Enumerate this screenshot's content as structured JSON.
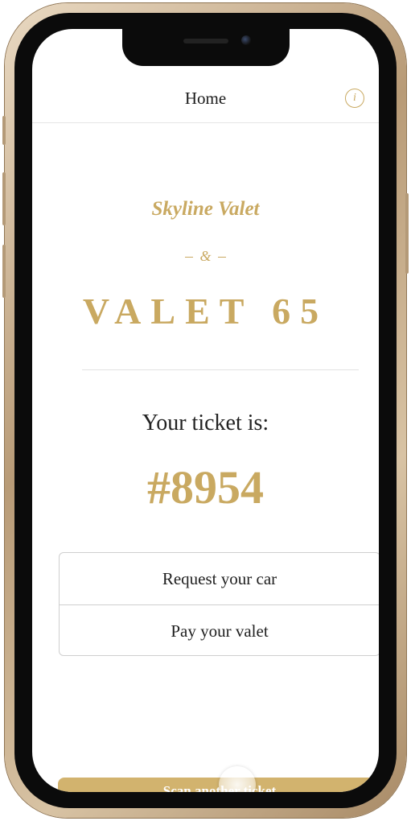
{
  "nav": {
    "title": "Home",
    "info_icon": "info-icon",
    "info_glyph": "i"
  },
  "brand": {
    "script_name": "Skyline Valet",
    "ampersand": "&",
    "logo_text": "VALET 65"
  },
  "ticket": {
    "label": "Your ticket is:",
    "number": "#8954"
  },
  "actions": [
    {
      "label": "Request your car"
    },
    {
      "label": "Pay your valet"
    }
  ],
  "footer": {
    "scan_label": "Scan another ticket"
  },
  "colors": {
    "accent": "#c9a961",
    "button": "#d2b36e",
    "frame": "#b89b77"
  }
}
